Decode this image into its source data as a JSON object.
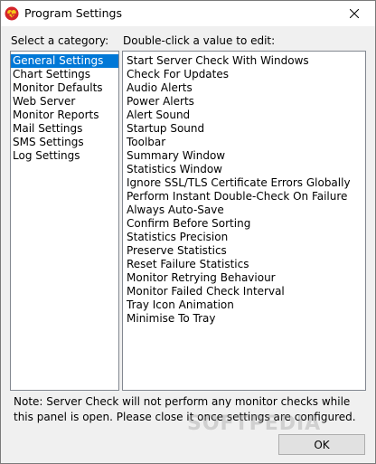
{
  "window": {
    "title": "Program Settings",
    "icon": "app-heart-icon",
    "close_icon": "close-icon"
  },
  "category_panel": {
    "label": "Select a category:",
    "items": [
      {
        "label": "General Settings",
        "selected": true
      },
      {
        "label": "Chart Settings",
        "selected": false
      },
      {
        "label": "Monitor Defaults",
        "selected": false
      },
      {
        "label": "Web Server",
        "selected": false
      },
      {
        "label": "Monitor Reports",
        "selected": false
      },
      {
        "label": "Mail Settings",
        "selected": false
      },
      {
        "label": "SMS Settings",
        "selected": false
      },
      {
        "label": "Log Settings",
        "selected": false
      }
    ]
  },
  "values_panel": {
    "label": "Double-click a value to edit:",
    "items": [
      "Start Server Check With Windows",
      "Check For Updates",
      "Audio Alerts",
      "Power Alerts",
      "Alert Sound",
      "Startup Sound",
      "Toolbar",
      "Summary Window",
      "Statistics Window",
      "Ignore SSL/TLS Certificate Errors Globally",
      "Perform Instant Double-Check On Failure",
      "Always Auto-Save",
      "Confirm Before Sorting",
      "Statistics Precision",
      "Preserve Statistics",
      "Reset Failure Statistics",
      "Monitor Retrying Behaviour",
      "Monitor Failed Check Interval",
      "Tray Icon Animation",
      "Minimise To Tray"
    ]
  },
  "note": "Note: Server Check will not perform any monitor checks while this panel is open. Please close it once settings are configured.",
  "ok_button": "OK",
  "watermark": "SOFTPEDIA",
  "colors": {
    "selection": "#0078d7",
    "icon_red": "#d4252a",
    "icon_yellow": "#f5c518"
  }
}
